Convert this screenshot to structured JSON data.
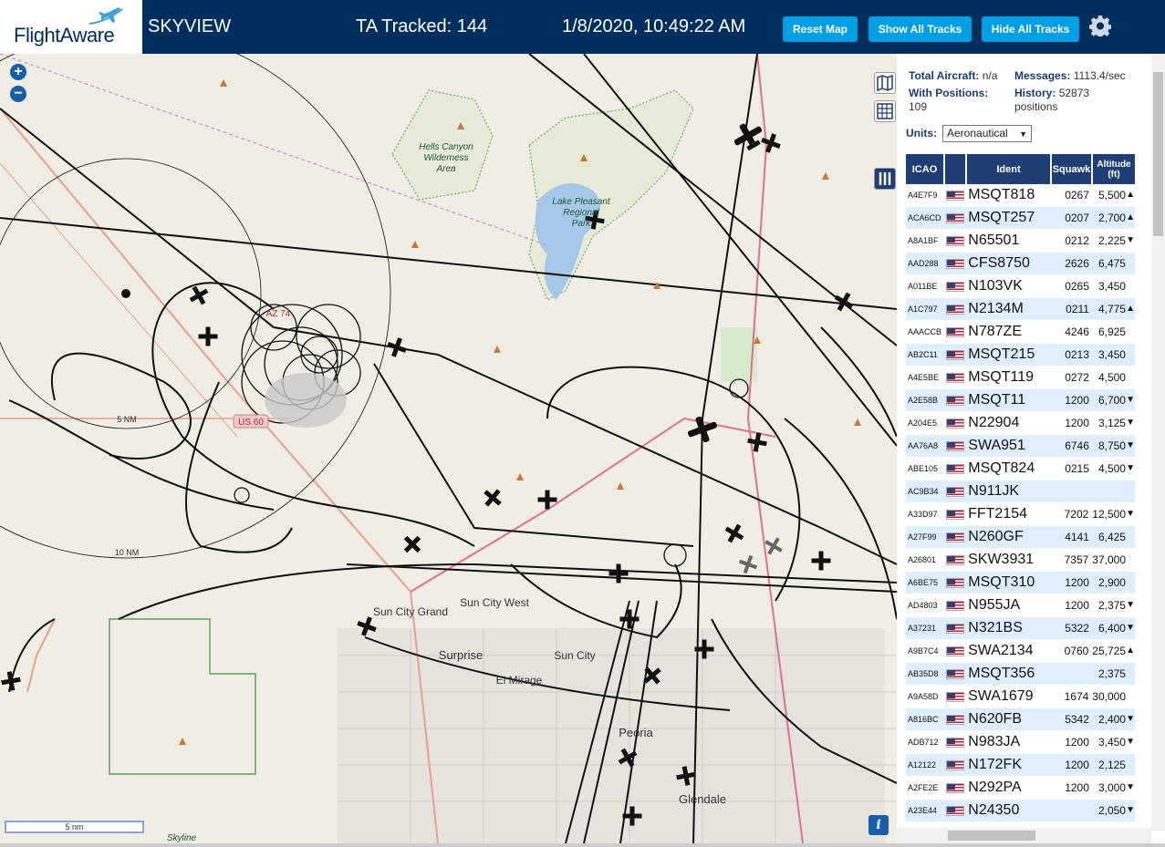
{
  "header": {
    "brand": "FlightAware",
    "title": "SKYVIEW",
    "ta_tracked": "TA Tracked: 144",
    "datetime": "1/8/2020, 10:49:22 AM",
    "reset_map": "Reset Map",
    "show_all_tracks": "Show All Tracks",
    "hide_all_tracks": "Hide All Tracks"
  },
  "map": {
    "labels": {
      "hells_canyon_1": "Hells Canyon",
      "hells_canyon_2": "Wilderness",
      "hells_canyon_3": "Area",
      "lake_pleasant_1": "Lake Pleasant",
      "lake_pleasant_2": "Regional",
      "lake_pleasant_3": "Park",
      "sun_city_grand": "Sun City Grand",
      "sun_city_west": "Sun City West",
      "surprise": "Surprise",
      "sun_city": "Sun City",
      "el_mirage": "El Mirage",
      "peoria": "Peoria",
      "glendale": "Glendale",
      "skyline": "Skyline",
      "us60": "US 60",
      "az74": "AZ 74",
      "ring_5nm": "5 NM",
      "ring_10nm": "10 NM"
    },
    "scale": "5 nm",
    "info": "i"
  },
  "stats": {
    "total_aircraft_label": "Total Aircraft:",
    "total_aircraft_value": "n/a",
    "with_positions_label": "With Positions:",
    "with_positions_value": "109",
    "messages_label": "Messages:",
    "messages_value": "1113.4/sec",
    "history_label": "History:",
    "history_value": "52873",
    "history_unit": "positions"
  },
  "units": {
    "label": "Units:",
    "value": "Aeronautical"
  },
  "table": {
    "headers": {
      "icao": "ICAO",
      "ident": "Ident",
      "squawk": "Squawk",
      "altitude": "Altitude (ft)"
    },
    "rows": [
      {
        "icao": "A4E7F9",
        "ident": "MSQT818",
        "squawk": "0267",
        "alt": "5,500",
        "trend": "▲"
      },
      {
        "icao": "ACA6CD",
        "ident": "MSQT257",
        "squawk": "0207",
        "alt": "2,700",
        "trend": "▲"
      },
      {
        "icao": "A8A1BF",
        "ident": "N65501",
        "squawk": "0212",
        "alt": "2,225",
        "trend": "▼"
      },
      {
        "icao": "AAD288",
        "ident": "CFS8750",
        "squawk": "2626",
        "alt": "6,475",
        "trend": ""
      },
      {
        "icao": "A011BE",
        "ident": "N103VK",
        "squawk": "0265",
        "alt": "3,450",
        "trend": ""
      },
      {
        "icao": "A1C797",
        "ident": "N2134M",
        "squawk": "0211",
        "alt": "4,775",
        "trend": "▲"
      },
      {
        "icao": "AAACCB",
        "ident": "N787ZE",
        "squawk": "4246",
        "alt": "6,925",
        "trend": ""
      },
      {
        "icao": "AB2C11",
        "ident": "MSQT215",
        "squawk": "0213",
        "alt": "3,450",
        "trend": ""
      },
      {
        "icao": "A4E5BE",
        "ident": "MSQT119",
        "squawk": "0272",
        "alt": "4,500",
        "trend": ""
      },
      {
        "icao": "A2E58B",
        "ident": "MSQT11",
        "squawk": "1200",
        "alt": "6,700",
        "trend": "▼"
      },
      {
        "icao": "A204E5",
        "ident": "N22904",
        "squawk": "1200",
        "alt": "3,125",
        "trend": "▼"
      },
      {
        "icao": "AA76A8",
        "ident": "SWA951",
        "squawk": "6746",
        "alt": "8,750",
        "trend": "▼"
      },
      {
        "icao": "ABE105",
        "ident": "MSQT824",
        "squawk": "0215",
        "alt": "4,500",
        "trend": "▼"
      },
      {
        "icao": "AC9B34",
        "ident": "N911JK",
        "squawk": "",
        "alt": "",
        "trend": ""
      },
      {
        "icao": "A33D97",
        "ident": "FFT2154",
        "squawk": "7202",
        "alt": "12,500",
        "trend": "▼"
      },
      {
        "icao": "A27F99",
        "ident": "N260GF",
        "squawk": "4141",
        "alt": "6,425",
        "trend": ""
      },
      {
        "icao": "A26801",
        "ident": "SKW3931",
        "squawk": "7357",
        "alt": "37,000",
        "trend": ""
      },
      {
        "icao": "A6BE75",
        "ident": "MSQT310",
        "squawk": "1200",
        "alt": "2,900",
        "trend": ""
      },
      {
        "icao": "AD4803",
        "ident": "N955JA",
        "squawk": "1200",
        "alt": "2,375",
        "trend": "▼"
      },
      {
        "icao": "A37231",
        "ident": "N321BS",
        "squawk": "5322",
        "alt": "6,400",
        "trend": "▼"
      },
      {
        "icao": "A9B7C4",
        "ident": "SWA2134",
        "squawk": "0760",
        "alt": "25,725",
        "trend": "▲"
      },
      {
        "icao": "AB35D8",
        "ident": "MSQT356",
        "squawk": "",
        "alt": "2,375",
        "trend": ""
      },
      {
        "icao": "A9A58D",
        "ident": "SWA1679",
        "squawk": "1674",
        "alt": "30,000",
        "trend": ""
      },
      {
        "icao": "A816BC",
        "ident": "N620FB",
        "squawk": "5342",
        "alt": "2,400",
        "trend": "▼"
      },
      {
        "icao": "ADB712",
        "ident": "N983JA",
        "squawk": "1200",
        "alt": "3,450",
        "trend": "▼"
      },
      {
        "icao": "A12122",
        "ident": "N172FK",
        "squawk": "1200",
        "alt": "2,125",
        "trend": ""
      },
      {
        "icao": "A2FE2E",
        "ident": "N292PA",
        "squawk": "1200",
        "alt": "3,000",
        "trend": "▼"
      },
      {
        "icao": "A23E44",
        "ident": "N24350",
        "squawk": "",
        "alt": "2,050",
        "trend": "▼"
      }
    ]
  },
  "colors": {
    "header_bg": "#002f5d",
    "button_bg": "#009fe3",
    "table_header_bg": "#1f3f74",
    "row_alt_bg": "#dfeefd",
    "map_bg": "#f0ede4"
  }
}
